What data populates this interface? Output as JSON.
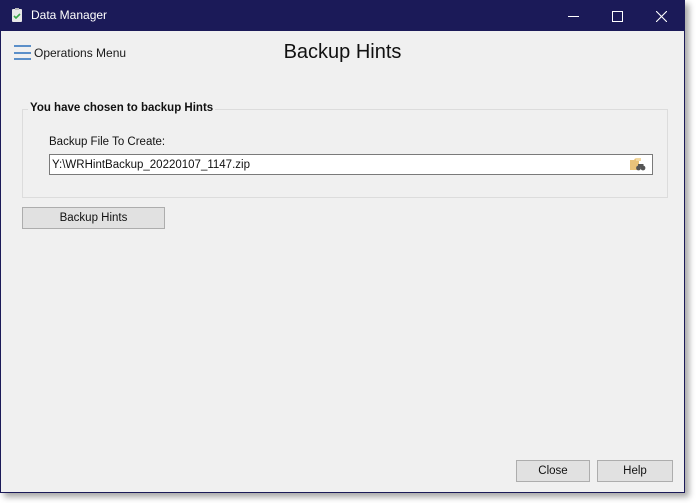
{
  "window": {
    "title": "Data Manager",
    "app_icon": "clipboard-check-icon",
    "controls": {
      "minimize": "minimize-icon",
      "maximize": "maximize-icon",
      "close": "close-icon"
    }
  },
  "header": {
    "menu_label": "Operations Menu",
    "menu_icon": "hamburger-icon",
    "page_title": "Backup Hints"
  },
  "group": {
    "legend": "You have chosen to backup Hints",
    "field_label": "Backup File To Create:",
    "file_value": "Y:\\WRHintBackup_20220107_1147.zip",
    "browse_icon": "folder-search-icon"
  },
  "actions": {
    "backup_label": "Backup Hints",
    "close_label": "Close",
    "help_label": "Help"
  },
  "colors": {
    "titlebar": "#1b1a58",
    "background": "#f0f0f0",
    "accent_menu": "#5b8fc9",
    "folder": "#e8c27a"
  }
}
